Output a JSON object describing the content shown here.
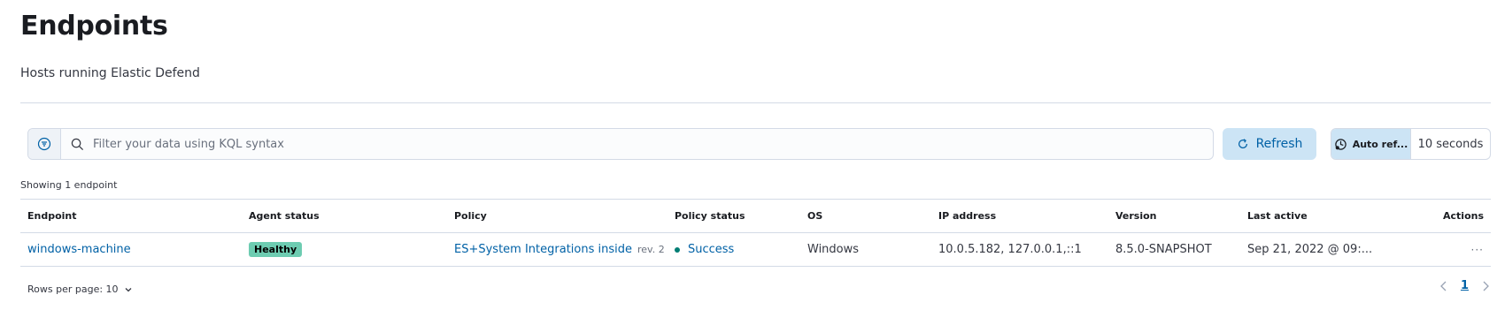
{
  "page": {
    "title": "Endpoints",
    "subtitle": "Hosts running Elastic Defend"
  },
  "search": {
    "placeholder": "Filter your data using KQL syntax",
    "value": ""
  },
  "toolbar": {
    "refresh_label": "Refresh",
    "auto_refresh_label": "Auto ref...",
    "auto_refresh_interval": "10 seconds"
  },
  "table": {
    "count_text": "Showing 1 endpoint",
    "columns": [
      "Endpoint",
      "Agent status",
      "Policy",
      "Policy status",
      "OS",
      "IP address",
      "Version",
      "Last active",
      "Actions"
    ],
    "rows": [
      {
        "endpoint": "windows-machine",
        "agent_status": "Healthy",
        "policy": "ES+System Integrations inside",
        "policy_rev": "rev. 2",
        "policy_status": "Success",
        "os": "Windows",
        "ip": "10.0.5.182, 127.0.0.1,::1",
        "version": "8.5.0-SNAPSHOT",
        "last_active": "Sep 21, 2022 @ 09:...",
        "actions": "···"
      }
    ]
  },
  "pagination": {
    "rows_per_page": "Rows per page: 10",
    "current_page": "1"
  },
  "colors": {
    "link": "#0061a6",
    "healthy_badge": "#6dccb1",
    "success_dot": "#017d73",
    "refresh_bg": "#cce4f5"
  }
}
